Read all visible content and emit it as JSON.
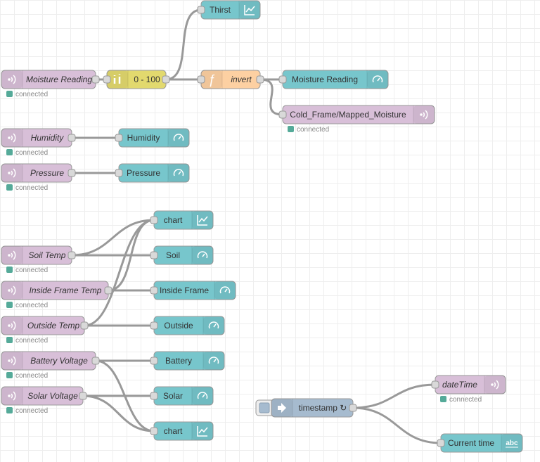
{
  "colors": {
    "mqtt": "#d8bfd8",
    "range": "#e2d96e",
    "function": "#fdd0a2",
    "dashboard": "#77c6cc",
    "inject": "#a6bbcf",
    "wire": "#999999",
    "status_connected": "#5a9"
  },
  "nodes": [
    {
      "id": "n1",
      "type": "mqtt-in",
      "label": "Moisture Reading",
      "italic": true,
      "status": "connected",
      "icon": "wifi-icon"
    },
    {
      "id": "n2",
      "type": "range",
      "label": "0 - 100",
      "icon": "range-icon"
    },
    {
      "id": "n3",
      "type": "function",
      "label": "invert",
      "italic": true,
      "icon": "function-icon"
    },
    {
      "id": "n4",
      "type": "chart",
      "label": "Thirst",
      "icon": "chart-icon"
    },
    {
      "id": "n5",
      "type": "gauge",
      "label": "Moisture Reading",
      "icon": "gauge-icon"
    },
    {
      "id": "n6",
      "type": "mqtt-out",
      "label": "Cold_Frame/Mapped_Moisture",
      "status": "connected",
      "icon": "wifi-icon"
    },
    {
      "id": "n7",
      "type": "mqtt-in",
      "label": "Humidity",
      "italic": true,
      "status": "connected",
      "icon": "wifi-icon"
    },
    {
      "id": "n8",
      "type": "gauge",
      "label": "Humidity",
      "icon": "gauge-icon"
    },
    {
      "id": "n9",
      "type": "mqtt-in",
      "label": "Pressure",
      "italic": true,
      "status": "connected",
      "icon": "wifi-icon"
    },
    {
      "id": "n10",
      "type": "gauge",
      "label": "Pressure",
      "icon": "gauge-icon"
    },
    {
      "id": "n11",
      "type": "chart",
      "label": "chart",
      "icon": "chart-icon"
    },
    {
      "id": "n12",
      "type": "mqtt-in",
      "label": "Soil Temp",
      "italic": true,
      "status": "connected",
      "icon": "wifi-icon"
    },
    {
      "id": "n13",
      "type": "gauge",
      "label": "Soil",
      "icon": "gauge-icon"
    },
    {
      "id": "n14",
      "type": "mqtt-in",
      "label": "Inside Frame Temp",
      "italic": true,
      "status": "connected",
      "icon": "wifi-icon"
    },
    {
      "id": "n15",
      "type": "gauge",
      "label": "Inside Frame",
      "icon": "gauge-icon"
    },
    {
      "id": "n16",
      "type": "mqtt-in",
      "label": "Outside Temp",
      "italic": true,
      "status": "connected",
      "icon": "wifi-icon"
    },
    {
      "id": "n17",
      "type": "gauge",
      "label": "Outside",
      "icon": "gauge-icon"
    },
    {
      "id": "n18",
      "type": "mqtt-in",
      "label": "Battery Voltage",
      "italic": true,
      "status": "connected",
      "icon": "wifi-icon"
    },
    {
      "id": "n19",
      "type": "gauge",
      "label": "Battery",
      "icon": "gauge-icon"
    },
    {
      "id": "n20",
      "type": "mqtt-in",
      "label": "Solar Voltage",
      "italic": true,
      "status": "connected",
      "icon": "wifi-icon"
    },
    {
      "id": "n21",
      "type": "gauge",
      "label": "Solar",
      "icon": "gauge-icon"
    },
    {
      "id": "n22",
      "type": "chart",
      "label": "chart",
      "icon": "chart-icon"
    },
    {
      "id": "n23",
      "type": "inject",
      "label": "timestamp ↻",
      "icon": "arrow-right-icon"
    },
    {
      "id": "n24",
      "type": "mqtt-out",
      "label": "dateTime",
      "italic": true,
      "status": "connected",
      "icon": "wifi-icon"
    },
    {
      "id": "n25",
      "type": "text",
      "label": "Current time",
      "icon": "abc-icon"
    }
  ],
  "wires": [
    [
      "n1",
      "n2"
    ],
    [
      "n2",
      "n4"
    ],
    [
      "n2",
      "n3"
    ],
    [
      "n3",
      "n5"
    ],
    [
      "n3",
      "n6"
    ],
    [
      "n7",
      "n8"
    ],
    [
      "n9",
      "n10"
    ],
    [
      "n12",
      "n11"
    ],
    [
      "n12",
      "n13"
    ],
    [
      "n14",
      "n11"
    ],
    [
      "n14",
      "n15"
    ],
    [
      "n16",
      "n11"
    ],
    [
      "n16",
      "n17"
    ],
    [
      "n18",
      "n19"
    ],
    [
      "n18",
      "n22"
    ],
    [
      "n20",
      "n21"
    ],
    [
      "n20",
      "n22"
    ],
    [
      "n23",
      "n24"
    ],
    [
      "n23",
      "n25"
    ]
  ]
}
